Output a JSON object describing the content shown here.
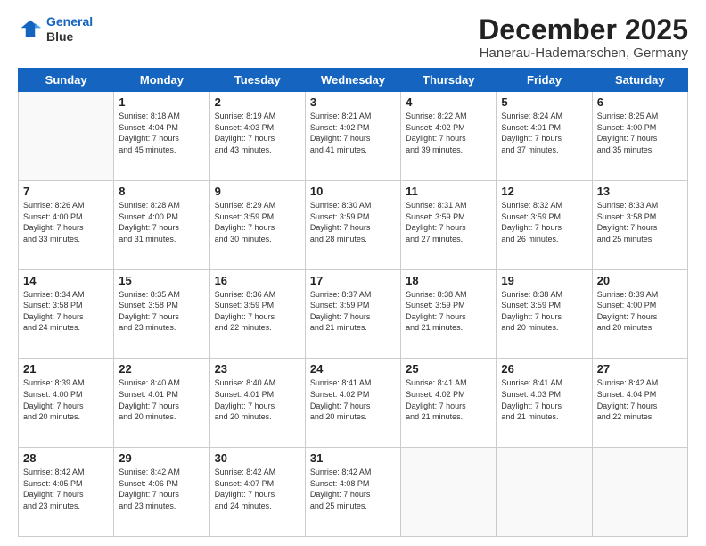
{
  "header": {
    "logo_line1": "General",
    "logo_line2": "Blue",
    "month": "December 2025",
    "location": "Hanerau-Hademarschen, Germany"
  },
  "days_of_week": [
    "Sunday",
    "Monday",
    "Tuesday",
    "Wednesday",
    "Thursday",
    "Friday",
    "Saturday"
  ],
  "weeks": [
    [
      {
        "day": "",
        "info": ""
      },
      {
        "day": "1",
        "info": "Sunrise: 8:18 AM\nSunset: 4:04 PM\nDaylight: 7 hours\nand 45 minutes."
      },
      {
        "day": "2",
        "info": "Sunrise: 8:19 AM\nSunset: 4:03 PM\nDaylight: 7 hours\nand 43 minutes."
      },
      {
        "day": "3",
        "info": "Sunrise: 8:21 AM\nSunset: 4:02 PM\nDaylight: 7 hours\nand 41 minutes."
      },
      {
        "day": "4",
        "info": "Sunrise: 8:22 AM\nSunset: 4:02 PM\nDaylight: 7 hours\nand 39 minutes."
      },
      {
        "day": "5",
        "info": "Sunrise: 8:24 AM\nSunset: 4:01 PM\nDaylight: 7 hours\nand 37 minutes."
      },
      {
        "day": "6",
        "info": "Sunrise: 8:25 AM\nSunset: 4:00 PM\nDaylight: 7 hours\nand 35 minutes."
      }
    ],
    [
      {
        "day": "7",
        "info": "Sunrise: 8:26 AM\nSunset: 4:00 PM\nDaylight: 7 hours\nand 33 minutes."
      },
      {
        "day": "8",
        "info": "Sunrise: 8:28 AM\nSunset: 4:00 PM\nDaylight: 7 hours\nand 31 minutes."
      },
      {
        "day": "9",
        "info": "Sunrise: 8:29 AM\nSunset: 3:59 PM\nDaylight: 7 hours\nand 30 minutes."
      },
      {
        "day": "10",
        "info": "Sunrise: 8:30 AM\nSunset: 3:59 PM\nDaylight: 7 hours\nand 28 minutes."
      },
      {
        "day": "11",
        "info": "Sunrise: 8:31 AM\nSunset: 3:59 PM\nDaylight: 7 hours\nand 27 minutes."
      },
      {
        "day": "12",
        "info": "Sunrise: 8:32 AM\nSunset: 3:59 PM\nDaylight: 7 hours\nand 26 minutes."
      },
      {
        "day": "13",
        "info": "Sunrise: 8:33 AM\nSunset: 3:58 PM\nDaylight: 7 hours\nand 25 minutes."
      }
    ],
    [
      {
        "day": "14",
        "info": "Sunrise: 8:34 AM\nSunset: 3:58 PM\nDaylight: 7 hours\nand 24 minutes."
      },
      {
        "day": "15",
        "info": "Sunrise: 8:35 AM\nSunset: 3:58 PM\nDaylight: 7 hours\nand 23 minutes."
      },
      {
        "day": "16",
        "info": "Sunrise: 8:36 AM\nSunset: 3:59 PM\nDaylight: 7 hours\nand 22 minutes."
      },
      {
        "day": "17",
        "info": "Sunrise: 8:37 AM\nSunset: 3:59 PM\nDaylight: 7 hours\nand 21 minutes."
      },
      {
        "day": "18",
        "info": "Sunrise: 8:38 AM\nSunset: 3:59 PM\nDaylight: 7 hours\nand 21 minutes."
      },
      {
        "day": "19",
        "info": "Sunrise: 8:38 AM\nSunset: 3:59 PM\nDaylight: 7 hours\nand 20 minutes."
      },
      {
        "day": "20",
        "info": "Sunrise: 8:39 AM\nSunset: 4:00 PM\nDaylight: 7 hours\nand 20 minutes."
      }
    ],
    [
      {
        "day": "21",
        "info": "Sunrise: 8:39 AM\nSunset: 4:00 PM\nDaylight: 7 hours\nand 20 minutes."
      },
      {
        "day": "22",
        "info": "Sunrise: 8:40 AM\nSunset: 4:01 PM\nDaylight: 7 hours\nand 20 minutes."
      },
      {
        "day": "23",
        "info": "Sunrise: 8:40 AM\nSunset: 4:01 PM\nDaylight: 7 hours\nand 20 minutes."
      },
      {
        "day": "24",
        "info": "Sunrise: 8:41 AM\nSunset: 4:02 PM\nDaylight: 7 hours\nand 20 minutes."
      },
      {
        "day": "25",
        "info": "Sunrise: 8:41 AM\nSunset: 4:02 PM\nDaylight: 7 hours\nand 21 minutes."
      },
      {
        "day": "26",
        "info": "Sunrise: 8:41 AM\nSunset: 4:03 PM\nDaylight: 7 hours\nand 21 minutes."
      },
      {
        "day": "27",
        "info": "Sunrise: 8:42 AM\nSunset: 4:04 PM\nDaylight: 7 hours\nand 22 minutes."
      }
    ],
    [
      {
        "day": "28",
        "info": "Sunrise: 8:42 AM\nSunset: 4:05 PM\nDaylight: 7 hours\nand 23 minutes."
      },
      {
        "day": "29",
        "info": "Sunrise: 8:42 AM\nSunset: 4:06 PM\nDaylight: 7 hours\nand 23 minutes."
      },
      {
        "day": "30",
        "info": "Sunrise: 8:42 AM\nSunset: 4:07 PM\nDaylight: 7 hours\nand 24 minutes."
      },
      {
        "day": "31",
        "info": "Sunrise: 8:42 AM\nSunset: 4:08 PM\nDaylight: 7 hours\nand 25 minutes."
      },
      {
        "day": "",
        "info": ""
      },
      {
        "day": "",
        "info": ""
      },
      {
        "day": "",
        "info": ""
      }
    ]
  ]
}
